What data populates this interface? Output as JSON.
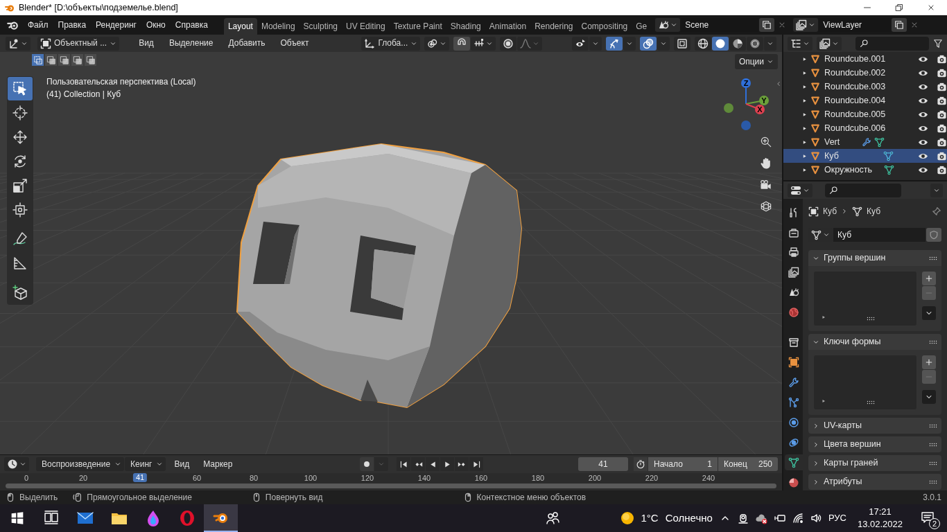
{
  "window": {
    "title": "Blender* [D:\\объекты\\подземелье.blend]"
  },
  "menu": [
    "Файл",
    "Правка",
    "Рендеринг",
    "Окно",
    "Справка"
  ],
  "workspaces": [
    {
      "label": "Layout",
      "selected": true
    },
    {
      "label": "Modeling",
      "selected": false
    },
    {
      "label": "Sculpting",
      "selected": false
    },
    {
      "label": "UV Editing",
      "selected": false
    },
    {
      "label": "Texture Paint",
      "selected": false
    },
    {
      "label": "Shading",
      "selected": false
    },
    {
      "label": "Animation",
      "selected": false
    },
    {
      "label": "Rendering",
      "selected": false
    },
    {
      "label": "Compositing",
      "selected": false
    },
    {
      "label": "Ge",
      "selected": false
    }
  ],
  "scene": {
    "name": "Scene"
  },
  "view_layer": {
    "name": "ViewLayer"
  },
  "viewport": {
    "mode": "Объектный ...",
    "menus": [
      "Вид",
      "Выделение",
      "Добавить",
      "Объект"
    ],
    "orientation": "Глоба...",
    "toggles": [
      {
        "kind": "visibility",
        "on": false
      },
      {
        "kind": "gizmo",
        "on": true
      },
      {
        "kind": "overlay",
        "on": true
      },
      {
        "kind": "xray",
        "on": false
      }
    ],
    "shading": [
      {
        "kind": "wireframe",
        "selected": false
      },
      {
        "kind": "solid",
        "selected": true
      },
      {
        "kind": "material",
        "selected": false
      },
      {
        "kind": "rendered",
        "selected": false
      }
    ],
    "select_modes": [
      {
        "selected": true
      },
      {
        "selected": false
      },
      {
        "selected": false
      },
      {
        "selected": false
      },
      {
        "selected": false
      }
    ],
    "options": "Опции",
    "view_name": "Пользовательская перспектива (Local)",
    "collection_line": "(41) Collection | Куб",
    "tools": [
      {
        "kind": "select",
        "selected": true
      },
      {
        "kind": "cursor",
        "selected": false
      },
      {
        "kind": "move",
        "selected": false
      },
      {
        "kind": "rotate",
        "selected": false
      },
      {
        "kind": "scale",
        "selected": false
      },
      {
        "kind": "transform",
        "selected": false
      },
      {
        "kind": "annotate",
        "selected": false
      },
      {
        "kind": "measure",
        "selected": false
      },
      {
        "kind": "add-cube",
        "selected": false
      }
    ],
    "axes": [
      {
        "label": "Z",
        "color": "#2f6fd8"
      },
      {
        "label": "Y",
        "color": "#6ba03a"
      },
      {
        "label": "X",
        "color": "#e04050"
      }
    ],
    "nav_buttons": [
      {
        "kind": "zoom"
      },
      {
        "kind": "pan"
      },
      {
        "kind": "camera"
      },
      {
        "kind": "ortho"
      }
    ]
  },
  "outliner": {
    "items": [
      {
        "name": "Roundcube.001",
        "selected": false,
        "modifier": false,
        "mesh_data": false
      },
      {
        "name": "Roundcube.002",
        "selected": false,
        "modifier": false,
        "mesh_data": false
      },
      {
        "name": "Roundcube.003",
        "selected": false,
        "modifier": false,
        "mesh_data": false
      },
      {
        "name": "Roundcube.004",
        "selected": false,
        "modifier": false,
        "mesh_data": false
      },
      {
        "name": "Roundcube.005",
        "selected": false,
        "modifier": false,
        "mesh_data": false
      },
      {
        "name": "Roundcube.006",
        "selected": false,
        "modifier": false,
        "mesh_data": false
      },
      {
        "name": "Vert",
        "selected": false,
        "modifier": true,
        "mesh_data": true
      },
      {
        "name": "Куб",
        "selected": true,
        "modifier": false,
        "mesh_data": true
      },
      {
        "name": "Окружность",
        "selected": false,
        "modifier": false,
        "mesh_data": true
      }
    ]
  },
  "properties": {
    "tabs": [
      {
        "kind": "tool",
        "selected": false
      },
      {
        "kind": "render",
        "selected": false
      },
      {
        "kind": "output",
        "selected": false
      },
      {
        "kind": "view-layer",
        "selected": false
      },
      {
        "kind": "scene",
        "selected": false
      },
      {
        "kind": "world",
        "selected": false
      },
      {
        "kind": "collection",
        "selected": false
      },
      {
        "kind": "object",
        "selected": false
      },
      {
        "kind": "modifiers",
        "selected": false
      },
      {
        "kind": "particles",
        "selected": false
      },
      {
        "kind": "physics",
        "selected": false
      },
      {
        "kind": "constraints",
        "selected": false
      },
      {
        "kind": "data",
        "selected": true
      },
      {
        "kind": "material",
        "selected": false
      }
    ],
    "object": "Куб",
    "data": "Куб",
    "mesh_name": "Куб",
    "panels": [
      {
        "title": "Группы вершин",
        "expanded": true
      },
      {
        "title": "Ключи формы",
        "expanded": true
      },
      {
        "title": "UV-карты",
        "expanded": false
      },
      {
        "title": "Цвета вершин",
        "expanded": false
      },
      {
        "title": "Карты граней",
        "expanded": false
      },
      {
        "title": "Атрибуты",
        "expanded": false
      }
    ]
  },
  "timeline": {
    "menus": [
      {
        "label": "Воспроизведение",
        "kind": "dropdown"
      },
      {
        "label": "Кеинг",
        "kind": "dropdown"
      },
      {
        "label": "Вид",
        "kind": "menu"
      },
      {
        "label": "Маркер",
        "kind": "menu"
      }
    ],
    "current_frame": "41",
    "start_label": "Начало",
    "start": "1",
    "end_label": "Конец",
    "end": "250",
    "ticks": [
      {
        "label": "0",
        "selected": false
      },
      {
        "label": "20",
        "selected": false
      },
      {
        "label": "41",
        "selected": true
      },
      {
        "label": "60",
        "selected": false
      },
      {
        "label": "80",
        "selected": false
      },
      {
        "label": "100",
        "selected": false
      },
      {
        "label": "120",
        "selected": false
      },
      {
        "label": "140",
        "selected": false
      },
      {
        "label": "160",
        "selected": false
      },
      {
        "label": "180",
        "selected": false
      },
      {
        "label": "200",
        "selected": false
      },
      {
        "label": "220",
        "selected": false
      },
      {
        "label": "240",
        "selected": false
      }
    ]
  },
  "status_bar": {
    "hints": [
      {
        "text": "Выделить",
        "kind": "left"
      },
      {
        "text": "Прямоугольное выделение",
        "kind": "drag"
      },
      {
        "text": "Повернуть вид",
        "kind": "middle"
      },
      {
        "text": "Контекстное меню объектов",
        "kind": "right"
      }
    ],
    "version": "3.0.1"
  },
  "taskbar": {
    "apps": [
      {
        "kind": "task-view",
        "selected": false
      },
      {
        "kind": "mail",
        "selected": false
      },
      {
        "kind": "explorer",
        "selected": false
      },
      {
        "kind": "flame",
        "selected": false
      },
      {
        "kind": "ring",
        "selected": false
      },
      {
        "kind": "blender",
        "selected": true
      }
    ],
    "temperature": "1°C",
    "condition": "Солнечно",
    "language": "РУС",
    "time": "17:21",
    "date": "13.02.2022",
    "notifications": "2"
  }
}
